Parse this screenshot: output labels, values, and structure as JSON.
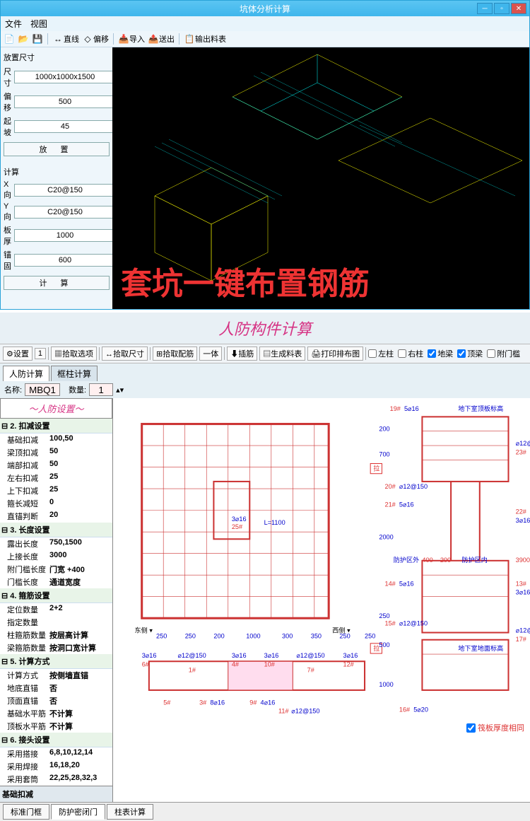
{
  "win1": {
    "title": "坑体分析计算",
    "menu": [
      "文件",
      "视图"
    ],
    "toolbar": [
      {
        "icon": "📄"
      },
      {
        "icon": "📂"
      },
      {
        "icon": "💾"
      },
      {
        "sep": true
      },
      {
        "icon": "↔",
        "label": "直线"
      },
      {
        "icon": "◇",
        "label": "偏移"
      },
      {
        "sep": true
      },
      {
        "icon": "📥",
        "label": "导入"
      },
      {
        "icon": "📤",
        "label": "送出"
      },
      {
        "sep": true
      },
      {
        "icon": "📋",
        "label": "输出料表"
      }
    ],
    "left": {
      "section1_label": "放置尺寸",
      "fields1": [
        {
          "label": "尺寸",
          "value": "1000x1000x1500"
        },
        {
          "label": "偏移",
          "value": "500"
        },
        {
          "label": "起坡",
          "value": "45"
        }
      ],
      "btn1": "放 置",
      "section2_label": "计算",
      "fields2": [
        {
          "label": "X向",
          "value": "C20@150"
        },
        {
          "label": "Y向",
          "value": "C20@150"
        },
        {
          "label": "板厚",
          "value": "1000"
        },
        {
          "label": "锚固",
          "value": "600"
        }
      ],
      "btn2": "计 算"
    },
    "overlay_text": "套坑一键布置钢筋"
  },
  "win2": {
    "title": "人防构件计算",
    "toolbar": {
      "settings": "设置",
      "settings_val": "1",
      "pick_opt": "拾取选项",
      "pick_dim": "拾取尺寸",
      "pick_rebar": "拾取配筋",
      "mode": "一体",
      "insert": "插筋",
      "gen_table": "生成料表",
      "print": "打印排布图",
      "checks": [
        {
          "label": "左柱",
          "checked": false
        },
        {
          "label": "右柱",
          "checked": false
        },
        {
          "label": "地梁",
          "checked": true
        },
        {
          "label": "顶梁",
          "checked": true
        },
        {
          "label": "附门槛",
          "checked": false
        }
      ]
    },
    "top_tabs": [
      "人防计算",
      "框柱计算"
    ],
    "name_label": "名称:",
    "name_value": "MBQ1",
    "qty_label": "数量:",
    "qty_value": "1",
    "tree": {
      "header": "～人防设置～",
      "groups": [
        {
          "title": "⊟ 2. 扣减设置",
          "items": [
            {
              "k": "基础扣减",
              "v": "100,50"
            },
            {
              "k": "梁顶扣减",
              "v": "50"
            },
            {
              "k": "端部扣减",
              "v": "50"
            },
            {
              "k": "左右扣减",
              "v": "25"
            },
            {
              "k": "上下扣减",
              "v": "25"
            },
            {
              "k": "箍长减短",
              "v": "0"
            },
            {
              "k": "直锚判断",
              "v": "20"
            }
          ]
        },
        {
          "title": "⊟ 3. 长度设置",
          "items": [
            {
              "k": "露出长度",
              "v": "750,1500"
            },
            {
              "k": "上接长度",
              "v": "3000"
            },
            {
              "k": "附门槛长度",
              "v": "门宽 +400"
            },
            {
              "k": "门槛长度",
              "v": "通道宽度"
            }
          ]
        },
        {
          "title": "⊟ 4. 箍筋设置",
          "items": [
            {
              "k": "定位数量",
              "v": "2+2"
            },
            {
              "k": "指定数量",
              "v": ""
            },
            {
              "k": "柱箍筋数量",
              "v": "按层高计算"
            },
            {
              "k": "梁箍筋数量",
              "v": "按洞口宽计算"
            }
          ]
        },
        {
          "title": "⊟ 5. 计算方式",
          "items": [
            {
              "k": "计算方式",
              "v": "按侧墙直锚"
            },
            {
              "k": "地底直锚",
              "v": "否"
            },
            {
              "k": "顶面直锚",
              "v": "否"
            },
            {
              "k": "基础水平筋",
              "v": "不计算"
            },
            {
              "k": "顶板水平筋",
              "v": "不计算"
            }
          ]
        },
        {
          "title": "⊟ 6. 接头设置",
          "items": [
            {
              "k": "采用搭接",
              "v": "6,8,10,12,14"
            },
            {
              "k": "采用焊接",
              "v": "16,18,20"
            },
            {
              "k": "采用套筒",
              "v": "22,25,28,32,3"
            }
          ]
        }
      ],
      "footer": "基础扣减"
    },
    "dims_top": [
      "200",
      "700",
      "2000",
      "400",
      "200",
      "3900"
    ],
    "labels": {
      "east": "东侧",
      "west": "西侧",
      "top_right": "地下室顶板标高",
      "bottom_right": "地下室地面标高",
      "zone_out": "防护区外",
      "zone_in": "防护区内",
      "la": "拉",
      "rebar_thickness": "筏板厚度相同"
    },
    "bottom_dims": [
      "250",
      "250",
      "200",
      "1000",
      "300",
      "350",
      "250",
      "250"
    ],
    "bottom_tabs": [
      "标准门框",
      "防护密闭门",
      "柱表计算"
    ]
  }
}
